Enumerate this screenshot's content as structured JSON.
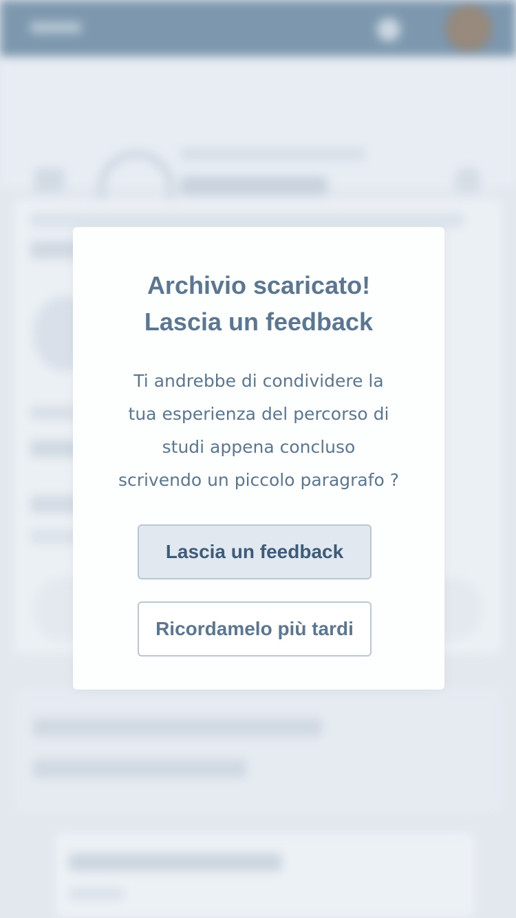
{
  "modal": {
    "title_line1": "Archivio scaricato!",
    "title_line2": "Lascia un feedback",
    "body_lines": [
      "Ti andrebbe di condividere la",
      "tua esperienza del percorso di",
      "studi appena concluso",
      "scrivendo un piccolo paragrafo ?"
    ],
    "primary_button": "Lascia un feedback",
    "secondary_button": "Ricordamelo più tardi"
  },
  "colors": {
    "topbar": "#6c8aa3",
    "text": "#5b7690",
    "primary_button_bg": "#e2e8ef",
    "primary_button_text": "#3e5b78"
  },
  "icons": [
    "menu-icon",
    "bell-icon",
    "search-icon",
    "avatar"
  ]
}
